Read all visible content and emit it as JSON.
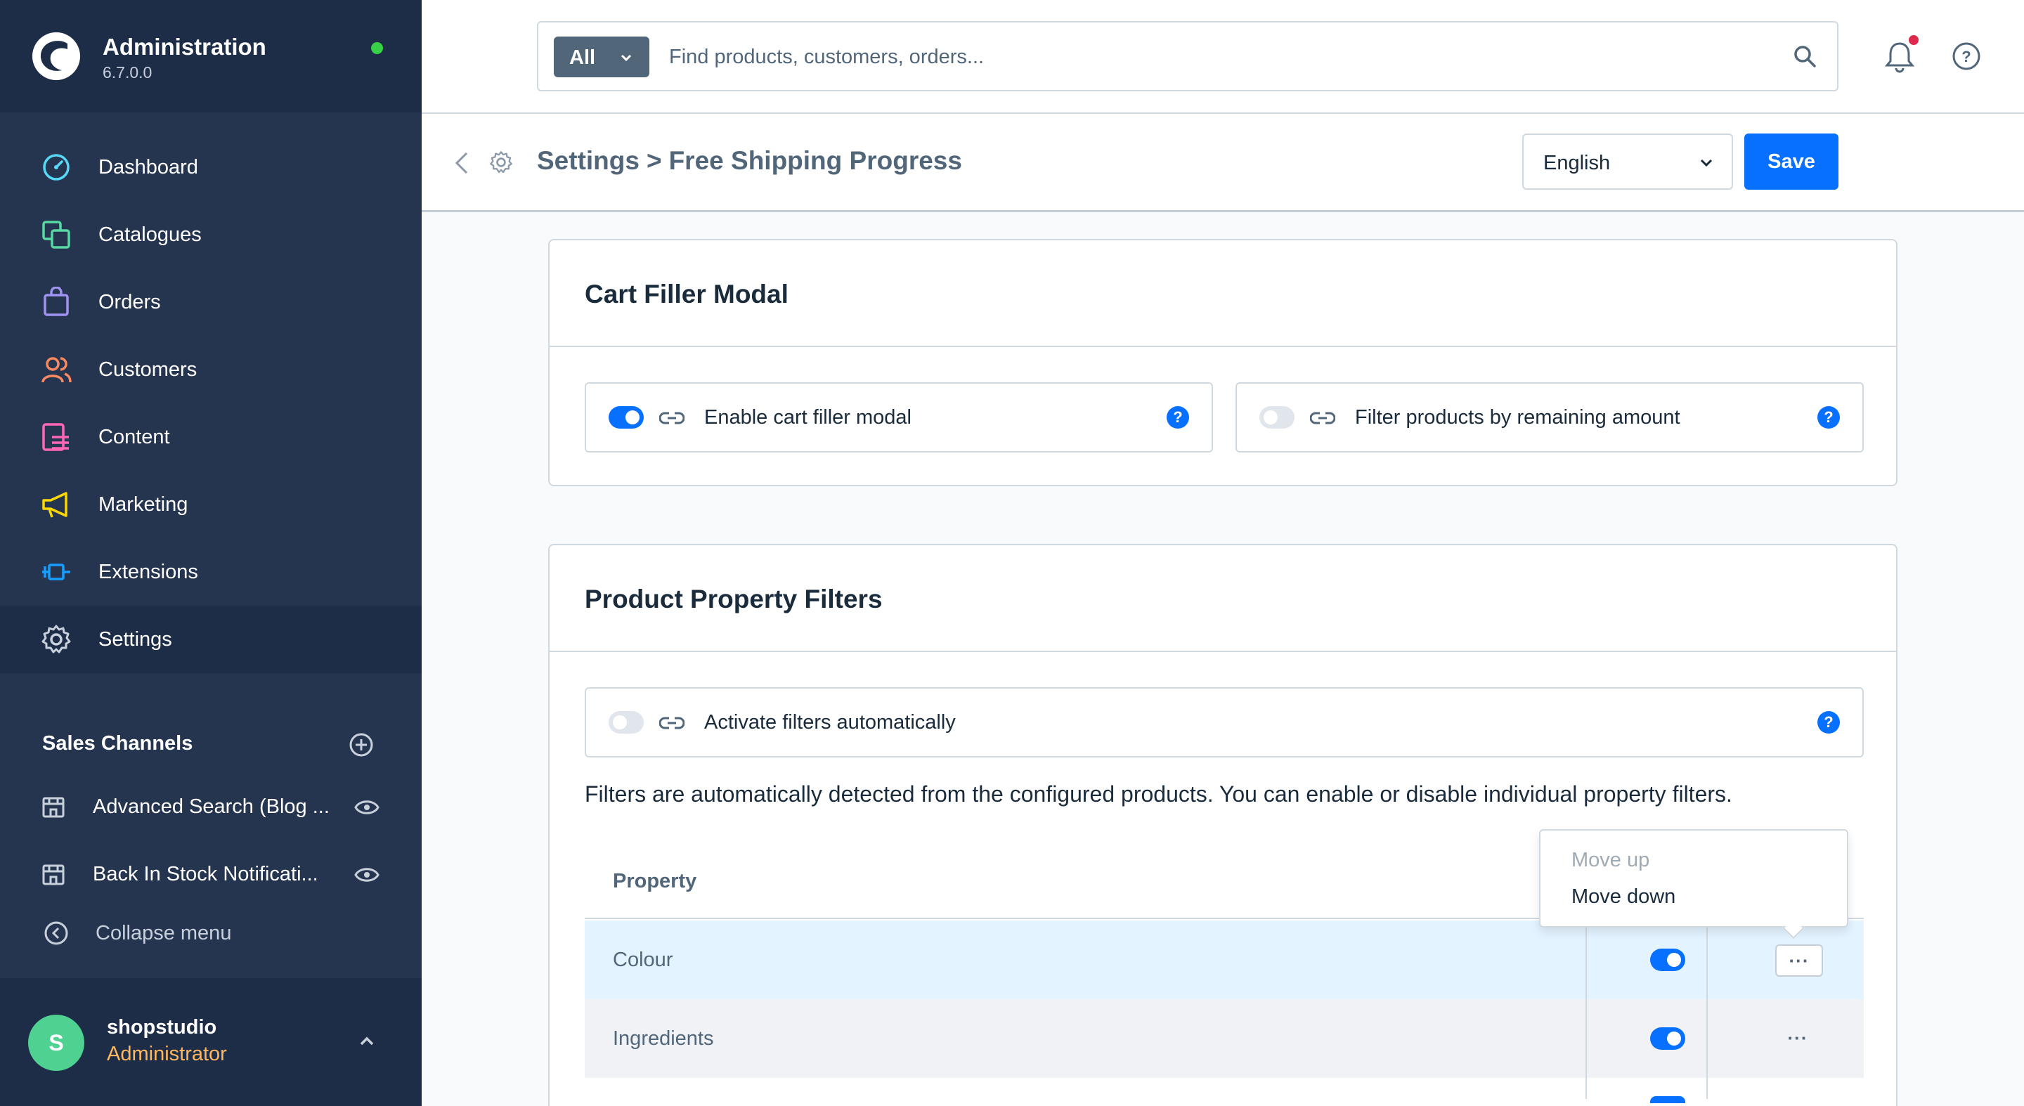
{
  "brand": {
    "title": "Administration",
    "version": "6.7.0.0"
  },
  "nav": {
    "items": [
      {
        "label": "Dashboard",
        "icon": "dashboard-icon",
        "color": "#57d9f6"
      },
      {
        "label": "Catalogues",
        "icon": "catalogues-icon",
        "color": "#57d9a3"
      },
      {
        "label": "Orders",
        "icon": "orders-icon",
        "color": "#a092f0"
      },
      {
        "label": "Customers",
        "icon": "customers-icon",
        "color": "#f88962"
      },
      {
        "label": "Content",
        "icon": "content-icon",
        "color": "#ff68b4"
      },
      {
        "label": "Marketing",
        "icon": "marketing-icon",
        "color": "#ffd700"
      },
      {
        "label": "Extensions",
        "icon": "extensions-icon",
        "color": "#189eff"
      },
      {
        "label": "Settings",
        "icon": "settings-icon",
        "color": "#c8d0dc"
      }
    ],
    "active": "Settings"
  },
  "sales_channels": {
    "header": "Sales Channels",
    "items": [
      {
        "label": "Advanced Search (Blog ..."
      },
      {
        "label": "Back In Stock Notificati..."
      }
    ],
    "collapse_label": "Collapse menu"
  },
  "user": {
    "initial": "S",
    "name": "shopstudio",
    "role": "Administrator"
  },
  "search": {
    "type_label": "All",
    "placeholder": "Find products, customers, orders..."
  },
  "smartbar": {
    "crumb_parent": "Settings",
    "crumb_separator": ">",
    "crumb_current": "Free Shipping Progress",
    "language": "English",
    "save_label": "Save"
  },
  "cart_filler": {
    "title": "Cart Filler Modal",
    "fields": [
      {
        "label": "Enable cart filler modal",
        "enabled": true
      },
      {
        "label": "Filter products by remaining amount",
        "enabled": false
      }
    ]
  },
  "property_filters": {
    "title": "Product Property Filters",
    "activate_label": "Activate filters automatically",
    "activate_enabled": false,
    "description": "Filters are automatically detected from the configured products. You can enable or disable individual property filters.",
    "column_property": "Property",
    "rows": [
      {
        "label": "Colour",
        "active": true
      },
      {
        "label": "Ingredients",
        "active": true
      }
    ],
    "context_menu": {
      "move_up": "Move up",
      "move_down": "Move down"
    }
  },
  "help_glyph": "?",
  "dots_glyph": "···",
  "colors": {
    "sidebar_bg": "#253550",
    "primary": "#0870ff",
    "status_online": "#37d046",
    "notification": "#de294c",
    "avatar": "#4ed191",
    "role": "#ffb75d"
  }
}
